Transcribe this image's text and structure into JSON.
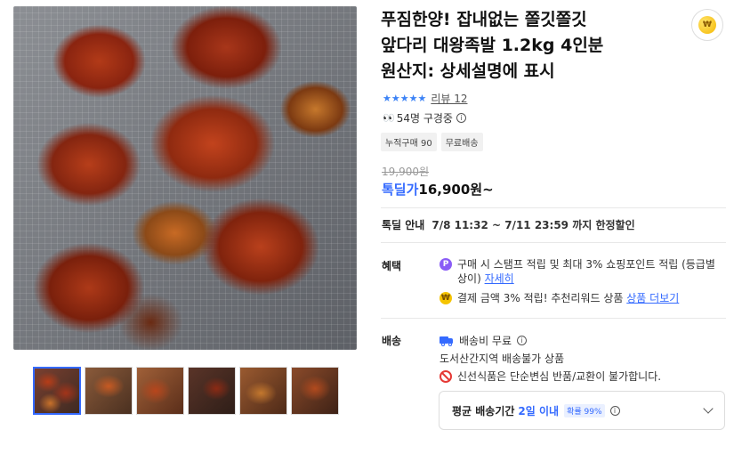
{
  "product": {
    "title_lines": [
      "푸짐한양! 잡내없는 쫄깃쫄깃",
      "앞다리 대왕족발 1.2kg 4인분",
      "원산지: 상세설명에 표시"
    ],
    "rating_stars": "★★★★★",
    "review_text": "리뷰 12",
    "viewers_icon": "👀",
    "viewers_text": "54명 구경중",
    "badges": [
      "누적구매 90",
      "무료배송"
    ],
    "original_price": "19,900원",
    "deal_label": "톡딜가",
    "deal_price": "16,900원~",
    "coin_icon_text": "₩"
  },
  "deal_notice": {
    "label": "톡딜 안내",
    "value": "7/8 11:32 ~ 7/11 23:59 까지 한정할인"
  },
  "benefit": {
    "label": "혜택",
    "item1_icon": "P",
    "item1_text": "구매 시 스탬프 적립 및 최대 3% 쇼핑포인트 적립 (등급별 상이) ",
    "item1_link": "자세히",
    "item2_icon": "₩",
    "item2_text": "결제 금액 3% 적립! 추천리워드 상품 ",
    "item2_link": "상품 더보기"
  },
  "shipping": {
    "label": "배송",
    "fee_text": "배송비 무료",
    "region_text": "도서산간지역 배송불가 상품",
    "fresh_text": "신선식품은 단순변심 반품/교환이 불가합니다.",
    "delivery_label": "평균 배송기간",
    "delivery_days": "2일 이내",
    "delivery_badge": "확률 99%"
  },
  "info_glyph": "i"
}
